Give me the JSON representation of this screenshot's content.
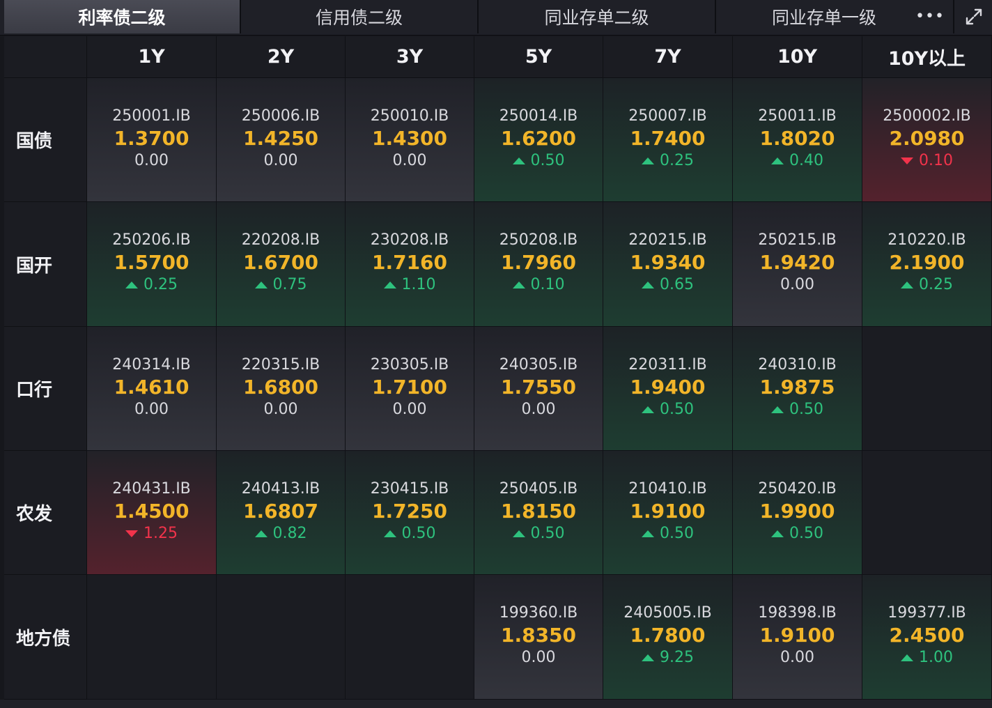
{
  "tabs": [
    {
      "label": "利率债二级",
      "active": true
    },
    {
      "label": "信用债二级",
      "active": false
    },
    {
      "label": "同业存单二级",
      "active": false
    },
    {
      "label": "同业存单一级",
      "active": false
    }
  ],
  "toolbar": {
    "more_icon": "more-icon",
    "expand_icon": "expand-icon"
  },
  "colors": {
    "yield": "#f2b529",
    "up": "#2ec27e",
    "down": "#f2334b",
    "text": "#d9d9de"
  },
  "columns": [
    "1Y",
    "2Y",
    "3Y",
    "5Y",
    "7Y",
    "10Y",
    "10Y以上"
  ],
  "rows": [
    {
      "label": "国债",
      "cells": [
        {
          "code": "250001.IB",
          "yield": "1.3700",
          "change": "0.00",
          "dir": "neutral"
        },
        {
          "code": "250006.IB",
          "yield": "1.4250",
          "change": "0.00",
          "dir": "neutral"
        },
        {
          "code": "250010.IB",
          "yield": "1.4300",
          "change": "0.00",
          "dir": "neutral"
        },
        {
          "code": "250014.IB",
          "yield": "1.6200",
          "change": "0.50",
          "dir": "up"
        },
        {
          "code": "250007.IB",
          "yield": "1.7400",
          "change": "0.25",
          "dir": "up"
        },
        {
          "code": "250011.IB",
          "yield": "1.8020",
          "change": "0.40",
          "dir": "up"
        },
        {
          "code": "2500002.IB",
          "yield": "2.0980",
          "change": "0.10",
          "dir": "down"
        }
      ]
    },
    {
      "label": "国开",
      "cells": [
        {
          "code": "250206.IB",
          "yield": "1.5700",
          "change": "0.25",
          "dir": "up"
        },
        {
          "code": "220208.IB",
          "yield": "1.6700",
          "change": "0.75",
          "dir": "up"
        },
        {
          "code": "230208.IB",
          "yield": "1.7160",
          "change": "1.10",
          "dir": "up"
        },
        {
          "code": "250208.IB",
          "yield": "1.7960",
          "change": "0.10",
          "dir": "up"
        },
        {
          "code": "220215.IB",
          "yield": "1.9340",
          "change": "0.65",
          "dir": "up"
        },
        {
          "code": "250215.IB",
          "yield": "1.9420",
          "change": "0.00",
          "dir": "neutral"
        },
        {
          "code": "210220.IB",
          "yield": "2.1900",
          "change": "0.25",
          "dir": "up"
        }
      ]
    },
    {
      "label": "口行",
      "cells": [
        {
          "code": "240314.IB",
          "yield": "1.4610",
          "change": "0.00",
          "dir": "neutral"
        },
        {
          "code": "220315.IB",
          "yield": "1.6800",
          "change": "0.00",
          "dir": "neutral"
        },
        {
          "code": "230305.IB",
          "yield": "1.7100",
          "change": "0.00",
          "dir": "neutral"
        },
        {
          "code": "240305.IB",
          "yield": "1.7550",
          "change": "0.00",
          "dir": "neutral"
        },
        {
          "code": "220311.IB",
          "yield": "1.9400",
          "change": "0.50",
          "dir": "up"
        },
        {
          "code": "240310.IB",
          "yield": "1.9875",
          "change": "0.50",
          "dir": "up"
        },
        null
      ]
    },
    {
      "label": "农发",
      "cells": [
        {
          "code": "240431.IB",
          "yield": "1.4500",
          "change": "1.25",
          "dir": "down"
        },
        {
          "code": "240413.IB",
          "yield": "1.6807",
          "change": "0.82",
          "dir": "up"
        },
        {
          "code": "230415.IB",
          "yield": "1.7250",
          "change": "0.50",
          "dir": "up"
        },
        {
          "code": "250405.IB",
          "yield": "1.8150",
          "change": "0.50",
          "dir": "up"
        },
        {
          "code": "210410.IB",
          "yield": "1.9100",
          "change": "0.50",
          "dir": "up"
        },
        {
          "code": "250420.IB",
          "yield": "1.9900",
          "change": "0.50",
          "dir": "up"
        },
        null
      ]
    },
    {
      "label": "地方债",
      "cells": [
        null,
        null,
        null,
        {
          "code": "199360.IB",
          "yield": "1.8350",
          "change": "0.00",
          "dir": "neutral"
        },
        {
          "code": "2405005.IB",
          "yield": "1.7800",
          "change": "9.25",
          "dir": "up"
        },
        {
          "code": "198398.IB",
          "yield": "1.9100",
          "change": "0.00",
          "dir": "neutral"
        },
        {
          "code": "199377.IB",
          "yield": "2.4500",
          "change": "1.00",
          "dir": "up"
        }
      ]
    }
  ]
}
